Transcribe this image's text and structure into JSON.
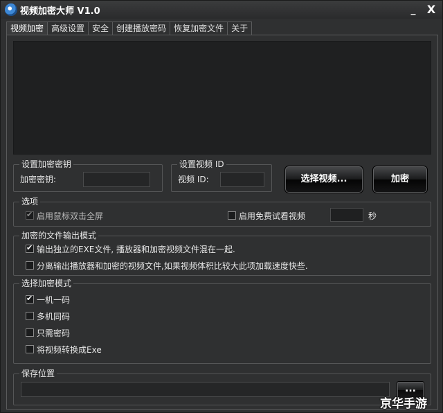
{
  "window": {
    "title": "视频加密大师 V1.0",
    "minimize": "_",
    "close": "X"
  },
  "tabs": [
    {
      "label": "视频加密",
      "active": true
    },
    {
      "label": "高级设置"
    },
    {
      "label": "安全"
    },
    {
      "label": "创建播放密码"
    },
    {
      "label": "恢复加密文件"
    },
    {
      "label": "关于"
    }
  ],
  "key_group": {
    "title": "设置加密密钥",
    "label": "加密密钥:",
    "value": ""
  },
  "id_group": {
    "title": "设置视频 ID",
    "label": "视频 ID:",
    "value": ""
  },
  "buttons": {
    "select_video": "选择视频...",
    "encrypt": "加密",
    "browse": "..."
  },
  "options": {
    "title": "选项",
    "fullscreen": {
      "label": "启用鼠标双击全屏",
      "checked": true,
      "disabled": true
    },
    "trial": {
      "label": "启用免费试看视频",
      "checked": false
    },
    "trial_seconds": "",
    "seconds_unit": "秒"
  },
  "output_mode": {
    "title": "加密的文件输出模式",
    "items": [
      {
        "label": "输出独立的EXE文件, 播放器和加密视频文件混在一起.",
        "checked": true
      },
      {
        "label": "分离输出播放器和加密的视频文件,如果视频体积比较大此项加载速度快些.",
        "checked": false
      }
    ]
  },
  "encrypt_mode": {
    "title": "选择加密模式",
    "items": [
      {
        "label": "一机一码",
        "checked": true
      },
      {
        "label": "多机同码",
        "checked": false
      },
      {
        "label": "只需密码",
        "checked": false
      },
      {
        "label": "将视频转换成Exe",
        "checked": false
      }
    ]
  },
  "save": {
    "title": "保存位置",
    "path": ""
  },
  "watermark": "京华手游",
  "colors": {
    "window_bg": "#2f3031",
    "video_area": "#1f2021",
    "text": "#e6e6e6"
  }
}
